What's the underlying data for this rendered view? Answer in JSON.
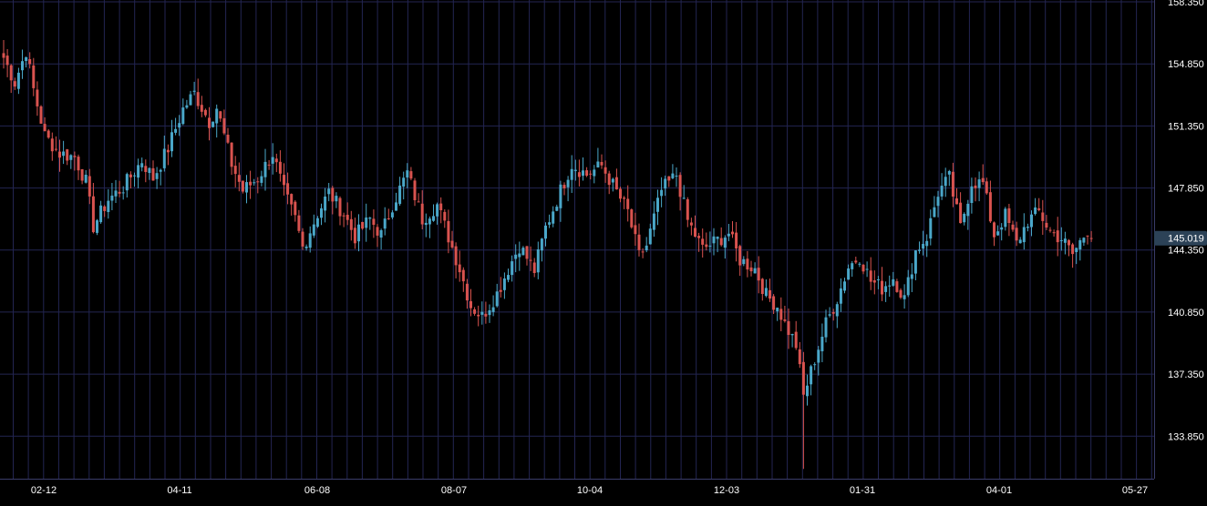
{
  "colors": {
    "background": "#000000",
    "grid": "#232552",
    "up": "#4aa7c9",
    "down": "#d9534f",
    "axis_text": "#ffffff",
    "price_tag_bg": "#2c4257"
  },
  "current_price_label": "145.019",
  "chart_data": {
    "type": "candlestick",
    "title": "",
    "xlabel": "",
    "ylabel": "",
    "ylim": [
      131.35,
      158.35
    ],
    "y_ticks": [
      "133.850",
      "137.350",
      "140.850",
      "144.350",
      "147.850",
      "151.350",
      "154.850",
      "158.350"
    ],
    "x_tick_labels": [
      "02-12",
      "04-11",
      "06-08",
      "08-07",
      "10-04",
      "12-03",
      "01-31",
      "04-01",
      "05-27"
    ],
    "current_price": 145.019,
    "grid": true,
    "anchors": [
      [
        0,
        155.2
      ],
      [
        3,
        153.8
      ],
      [
        6,
        155.6
      ],
      [
        8,
        153.4
      ],
      [
        11,
        150.8
      ],
      [
        15,
        149.8
      ],
      [
        19,
        149.6
      ],
      [
        22,
        148.2
      ],
      [
        24,
        145.7
      ],
      [
        28,
        147.2
      ],
      [
        32,
        147.9
      ],
      [
        37,
        149.4
      ],
      [
        40,
        148.4
      ],
      [
        44,
        150.1
      ],
      [
        48,
        152.3
      ],
      [
        51,
        153.2
      ],
      [
        55,
        151.6
      ],
      [
        57,
        152.4
      ],
      [
        61,
        149.2
      ],
      [
        64,
        147.7
      ],
      [
        68,
        148.4
      ],
      [
        72,
        149.8
      ],
      [
        75,
        147.6
      ],
      [
        78,
        146.1
      ],
      [
        80,
        144.5
      ],
      [
        84,
        146.4
      ],
      [
        87,
        147.6
      ],
      [
        91,
        146.4
      ],
      [
        94,
        145.1
      ],
      [
        98,
        146.1
      ],
      [
        101,
        145.2
      ],
      [
        104,
        146.9
      ],
      [
        108,
        148.7
      ],
      [
        112,
        146.1
      ],
      [
        116,
        146.9
      ],
      [
        119,
        145.1
      ],
      [
        122,
        143.3
      ],
      [
        125,
        141.2
      ],
      [
        128,
        140.6
      ],
      [
        132,
        141.9
      ],
      [
        135,
        143.3
      ],
      [
        138,
        144.6
      ],
      [
        142,
        143.2
      ],
      [
        145,
        145.6
      ],
      [
        149,
        147.7
      ],
      [
        152,
        149.2
      ],
      [
        156,
        148.6
      ],
      [
        160,
        149.1
      ],
      [
        163,
        148.0
      ],
      [
        167,
        146.5
      ],
      [
        170,
        144.0
      ],
      [
        172,
        144.6
      ],
      [
        176,
        147.7
      ],
      [
        180,
        148.6
      ],
      [
        183,
        146.0
      ],
      [
        187,
        144.4
      ],
      [
        191,
        144.9
      ],
      [
        194,
        145.3
      ],
      [
        197,
        143.8
      ],
      [
        201,
        143.3
      ],
      [
        204,
        141.8
      ],
      [
        207,
        141.2
      ],
      [
        209,
        140.2
      ],
      [
        212,
        139.0
      ],
      [
        214,
        136.1
      ],
      [
        217,
        138.2
      ],
      [
        220,
        140.2
      ],
      [
        223,
        141.6
      ],
      [
        226,
        143.4
      ],
      [
        229,
        144.0
      ],
      [
        232,
        142.6
      ],
      [
        235,
        142.2
      ],
      [
        238,
        142.8
      ],
      [
        241,
        141.6
      ],
      [
        244,
        144.3
      ],
      [
        247,
        145.1
      ],
      [
        250,
        147.6
      ],
      [
        253,
        148.4
      ],
      [
        256,
        145.6
      ],
      [
        259,
        148.2
      ],
      [
        262,
        148.1
      ],
      [
        265,
        145.2
      ],
      [
        268,
        146.3
      ],
      [
        271,
        144.7
      ],
      [
        274,
        146.0
      ],
      [
        277,
        146.5
      ],
      [
        280,
        145.4
      ],
      [
        283,
        145.0
      ],
      [
        286,
        144.1
      ],
      [
        290,
        145.5
      ],
      [
        291,
        145.02
      ]
    ],
    "candle_count": 292
  }
}
